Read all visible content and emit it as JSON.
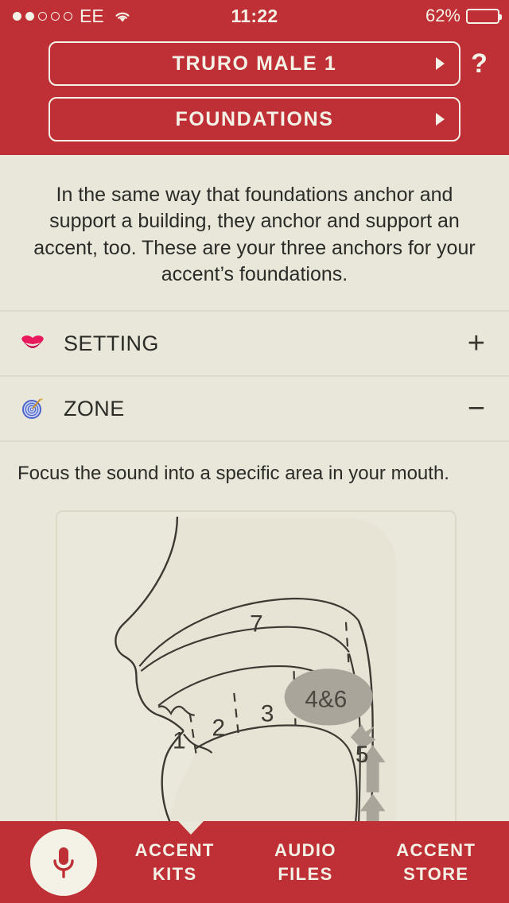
{
  "status_bar": {
    "signal_dots_filled": 2,
    "signal_dots_total": 5,
    "carrier": "EE",
    "wifi_icon": "wifi-icon",
    "time": "11:22",
    "battery_percent": "62%",
    "battery_level": 62
  },
  "header": {
    "accent_button": "TRURO MALE 1",
    "section_button": "FOUNDATIONS",
    "help_label": "?",
    "arrow_icon": "chevron-right-icon"
  },
  "intro": {
    "text": "In the same way that foundations anchor and support a building, they anchor and support an accent, too. These are your three anchors for your accent’s foundations."
  },
  "accordion": [
    {
      "id": "setting",
      "label": "SETTING",
      "icon": "lips-icon",
      "toggle": "+",
      "expanded": false
    },
    {
      "id": "zone",
      "label": "ZONE",
      "icon": "target-icon",
      "toggle": "−",
      "expanded": true
    }
  ],
  "zone_panel": {
    "description": "Focus the sound into a specific area in your mouth.",
    "diagram": {
      "name": "mouth-zones-diagram",
      "labels": [
        "1",
        "2",
        "3",
        "4&6",
        "5",
        "7"
      ],
      "highlight_label": "4&6",
      "airflow_label": "5"
    }
  },
  "tabbar": {
    "mic_icon": "microphone-icon",
    "active_tab": "ACCENT KITS",
    "tabs": [
      {
        "line1": "ACCENT",
        "line2": "KITS"
      },
      {
        "line1": "AUDIO",
        "line2": "FILES"
      },
      {
        "line1": "ACCENT",
        "line2": "STORE"
      }
    ]
  },
  "colors": {
    "brand_red": "#bf3036",
    "cream": "#f4f1e6",
    "page_bg": "#e9e7da",
    "text_dark": "#2b2b28",
    "diagram_gray": "#a9a59b"
  }
}
